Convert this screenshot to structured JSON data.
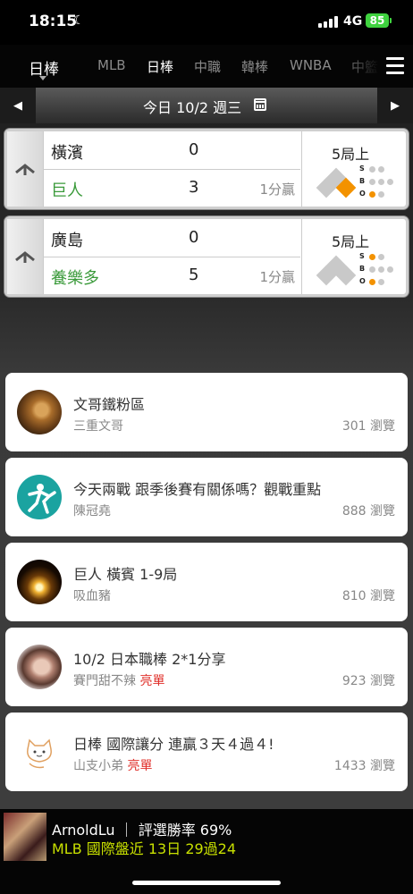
{
  "status_bar": {
    "time": "18:15",
    "network": "4G",
    "battery": "85"
  },
  "nav": {
    "current_league": "日棒",
    "tabs": [
      "MLB",
      "日棒",
      "中職",
      "韓棒",
      "WNBA",
      "中籃"
    ],
    "active_tab": "日棒"
  },
  "date_bar": {
    "label": "今日 10/2 週三"
  },
  "games": [
    {
      "away": {
        "name": "橫濱",
        "score": "0"
      },
      "home": {
        "name": "巨人",
        "score": "3",
        "note": "1分贏"
      },
      "inning": "5局上",
      "count": {
        "S": 0,
        "B": 0,
        "O": 1
      },
      "bases": {
        "first": true,
        "second": false,
        "third": false
      }
    },
    {
      "away": {
        "name": "廣島",
        "score": "0"
      },
      "home": {
        "name": "養樂多",
        "score": "5",
        "note": "1分贏"
      },
      "inning": "5局上",
      "count": {
        "S": 1,
        "B": 0,
        "O": 1
      },
      "bases": {
        "first": false,
        "second": false,
        "third": false
      }
    }
  ],
  "count_labels": {
    "S": "S",
    "B": "B",
    "O": "O"
  },
  "posts": [
    {
      "title": "文哥鐵粉區",
      "author": "三重文哥",
      "tag": "",
      "views": "301 瀏覽",
      "avatar": "lion-avatar"
    },
    {
      "title": "今天兩戰 跟季後賽有關係嗎？觀戰重點",
      "author": "陳冠堯",
      "tag": "",
      "views": "888 瀏覽",
      "avatar": "pitcher-avatar"
    },
    {
      "title": "巨人 橫賓 1-9局",
      "author": "吸血豬",
      "tag": "",
      "views": "810 瀏覽",
      "avatar": "candle-avatar"
    },
    {
      "title": "10/2 日本職棒 2*1分享",
      "author": "賽門甜不辣",
      "tag": "亮單",
      "views": "923 瀏覽",
      "avatar": "woman-avatar"
    },
    {
      "title": "日棒 國際讓分 連贏３天４過４!",
      "author": "山支小弟",
      "tag": "亮單",
      "views": "1433 瀏覽",
      "avatar": "cat-avatar"
    }
  ],
  "promo": {
    "line1": "ArnoldLu ｜ 評選勝率 69%",
    "line2": "MLB 國際盤近 13日 29過24"
  },
  "colors": {
    "win_green": "#3a9a3a",
    "orange": "#f39200",
    "promo_lime": "#c8e000",
    "tag_red": "#e0302a"
  }
}
